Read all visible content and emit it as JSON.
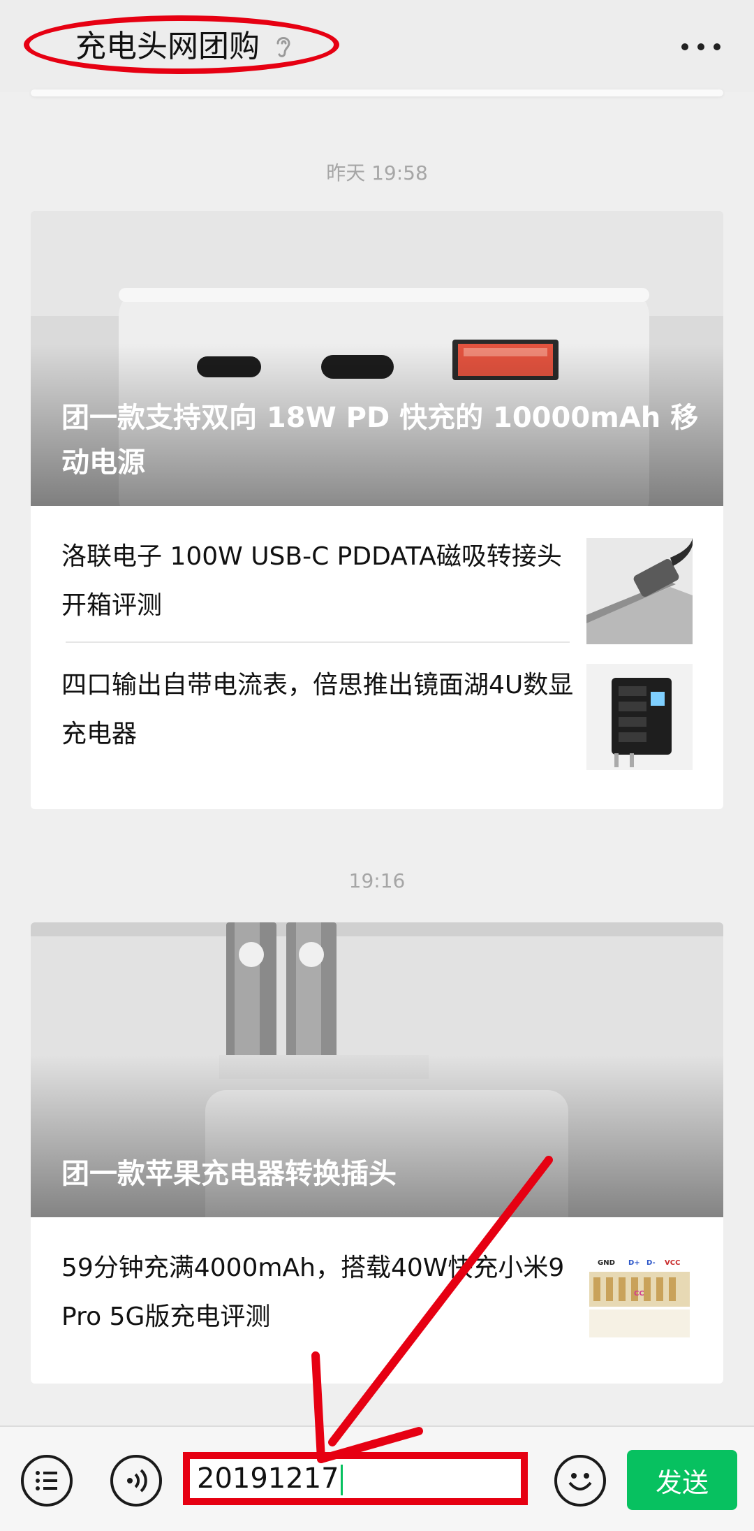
{
  "header": {
    "title": "充电头网团购",
    "icons": {
      "listen": "ear-icon",
      "more": "more-dots-icon"
    }
  },
  "messages": [
    {
      "timestamp": "昨天 19:58",
      "main_article": {
        "title": "团一款支持双向 18W PD 快充的 10000mAh 移动电源"
      },
      "sub_articles": [
        {
          "title": "洛联电子 100W USB-C PDDATA磁吸转接头开箱评测"
        },
        {
          "title": "四口输出自带电流表，倍思推出镜面湖4U数显充电器"
        }
      ]
    },
    {
      "timestamp": "19:16",
      "main_article": {
        "title": "团一款苹果充电器转换插头"
      },
      "sub_articles": [
        {
          "title": "59分钟充满4000mAh，搭载40W快充小米9 Pro 5G版充电评测",
          "thumb_labels": [
            "GND",
            "D+",
            "D-",
            "VCC",
            "CC"
          ]
        }
      ]
    }
  ],
  "input_bar": {
    "value": "20191217",
    "send_label": "发送",
    "icons": {
      "menu": "list-menu-icon",
      "voice": "voice-icon",
      "emoji": "emoji-icon"
    }
  },
  "colors": {
    "accent_green": "#07c160",
    "annotation_red": "#e60012"
  }
}
